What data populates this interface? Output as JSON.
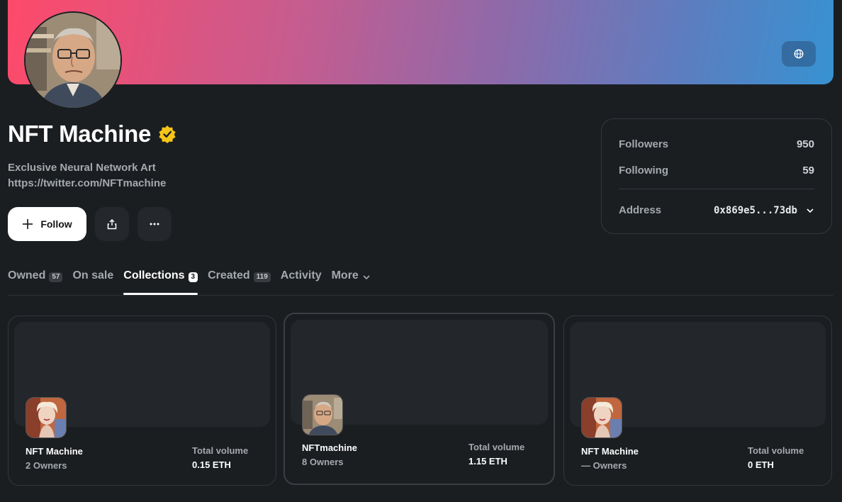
{
  "profile": {
    "name": "NFT Machine",
    "verified_icon": "verified-badge-icon",
    "description": "Exclusive Neural Network Art",
    "link": "https://twitter.com/NFTmachine"
  },
  "actions": {
    "follow_label": "Follow",
    "share_icon": "share-icon",
    "more_icon": "more-dots-icon"
  },
  "stats": {
    "followers_label": "Followers",
    "followers_value": "950",
    "following_label": "Following",
    "following_value": "59",
    "address_label": "Address",
    "address_value": "0x869e5...73db"
  },
  "tabs": [
    {
      "label": "Owned",
      "count": "57"
    },
    {
      "label": "On sale",
      "count": ""
    },
    {
      "label": "Collections",
      "count": "3"
    },
    {
      "label": "Created",
      "count": "119"
    },
    {
      "label": "Activity",
      "count": ""
    },
    {
      "label": "More",
      "count": ""
    }
  ],
  "collections": [
    {
      "name": "NFT Machine",
      "owners": "2 Owners",
      "volume_label": "Total volume",
      "volume": "0.15 ETH"
    },
    {
      "name": "NFTmachine",
      "owners": "8 Owners",
      "volume_label": "Total volume",
      "volume": "1.15 ETH"
    },
    {
      "name": "NFT Machine",
      "owners": "— Owners",
      "volume_label": "Total volume",
      "volume": "0 ETH"
    }
  ],
  "colors": {
    "background": "#1b1e21",
    "banner_start": "#fe4a6a",
    "banner_end": "#3792d2",
    "verified": "#f5c518"
  }
}
